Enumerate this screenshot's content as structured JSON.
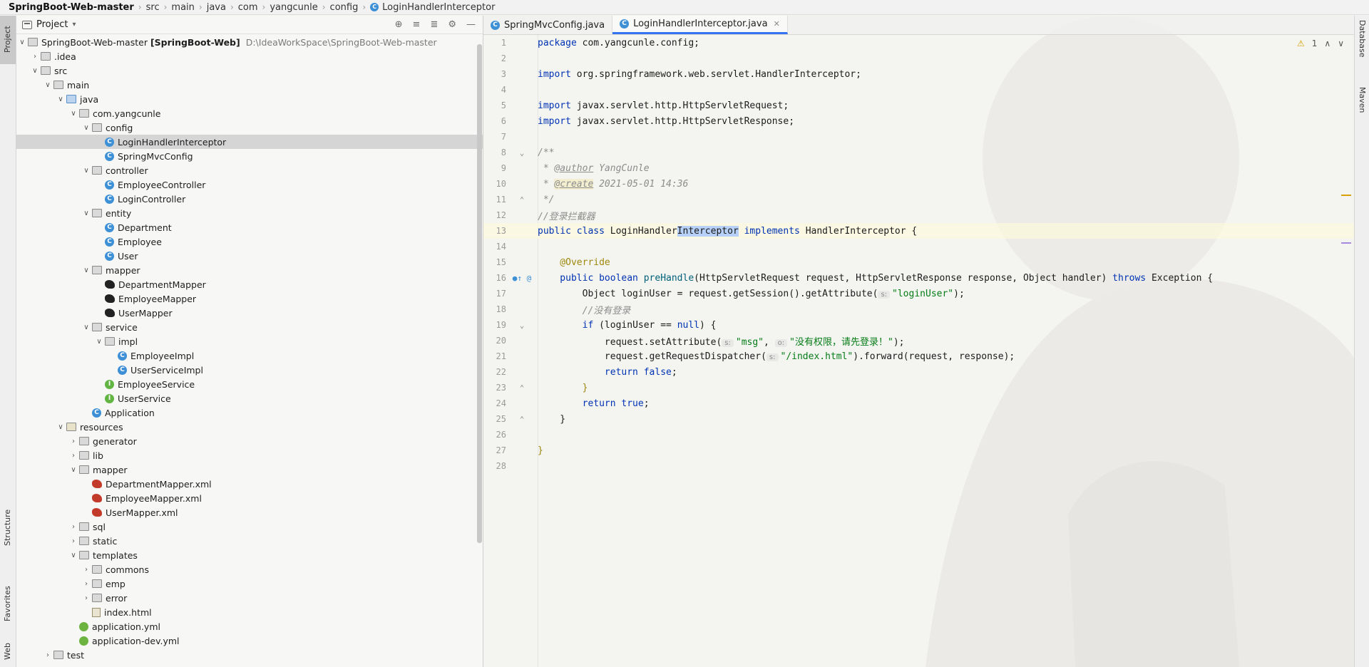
{
  "breadcrumb": {
    "items": [
      "SpringBoot-Web-master",
      "src",
      "main",
      "java",
      "com",
      "yangcunle",
      "config",
      "LoginHandlerInterceptor"
    ]
  },
  "left_strip": {
    "project": "Project",
    "structure": "Structure",
    "favorites": "Favorites",
    "web": "Web"
  },
  "right_strip": {
    "database": "Database",
    "maven": "Maven"
  },
  "project_panel": {
    "title": "Project",
    "root_name": "SpringBoot-Web-master",
    "root_module": "[SpringBoot-Web]",
    "root_path": "D:\\IdeaWorkSpace\\SpringBoot-Web-master",
    "items": [
      {
        "label": ".idea"
      },
      {
        "label": "src"
      },
      {
        "label": "main"
      },
      {
        "label": "java"
      },
      {
        "label": "com.yangcunle"
      },
      {
        "label": "config"
      },
      {
        "label": "LoginHandlerInterceptor"
      },
      {
        "label": "SpringMvcConfig"
      },
      {
        "label": "controller"
      },
      {
        "label": "EmployeeController"
      },
      {
        "label": "LoginController"
      },
      {
        "label": "entity"
      },
      {
        "label": "Department"
      },
      {
        "label": "Employee"
      },
      {
        "label": "User"
      },
      {
        "label": "mapper"
      },
      {
        "label": "DepartmentMapper"
      },
      {
        "label": "EmployeeMapper"
      },
      {
        "label": "UserMapper"
      },
      {
        "label": "service"
      },
      {
        "label": "impl"
      },
      {
        "label": "EmployeeImpl"
      },
      {
        "label": "UserServiceImpl"
      },
      {
        "label": "EmployeeService"
      },
      {
        "label": "UserService"
      },
      {
        "label": "Application"
      },
      {
        "label": "resources"
      },
      {
        "label": "generator"
      },
      {
        "label": "lib"
      },
      {
        "label": "mapper"
      },
      {
        "label": "DepartmentMapper.xml"
      },
      {
        "label": "EmployeeMapper.xml"
      },
      {
        "label": "UserMapper.xml"
      },
      {
        "label": "sql"
      },
      {
        "label": "static"
      },
      {
        "label": "templates"
      },
      {
        "label": "commons"
      },
      {
        "label": "emp"
      },
      {
        "label": "error"
      },
      {
        "label": "index.html"
      },
      {
        "label": "application.yml"
      },
      {
        "label": "application-dev.yml"
      },
      {
        "label": "test"
      }
    ]
  },
  "tabs": [
    {
      "label": "SpringMvcConfig.java",
      "active": false
    },
    {
      "label": "LoginHandlerInterceptor.java",
      "active": true
    }
  ],
  "editor": {
    "warning_count": "1",
    "line_numbers": [
      "1",
      "2",
      "3",
      "4",
      "5",
      "6",
      "7",
      "8",
      "9",
      "10",
      "11",
      "12",
      "13",
      "14",
      "15",
      "16",
      "17",
      "18",
      "19",
      "20",
      "21",
      "22",
      "23",
      "24",
      "25",
      "26",
      "27",
      "28"
    ],
    "code": {
      "l1_kw": "package",
      "l1_rest": " com.yangcunle.config;",
      "l3_kw": "import",
      "l3_rest": " org.springframework.web.servlet.HandlerInterceptor;",
      "l5_kw": "import",
      "l5_rest": " javax.servlet.http.HttpServletRequest;",
      "l6_kw": "import",
      "l6_rest": " javax.servlet.http.HttpServletResponse;",
      "l8": "/**",
      "l9_pre": " * ",
      "l9_tag": "@author",
      "l9_rest": " YangCunle",
      "l10_pre": " * ",
      "l10_tag": "@create",
      "l10_rest": " 2021-05-01 14:36",
      "l11": " */",
      "l12": "//登录拦截器",
      "l13_kw": "public class ",
      "l13_name": "LoginHandler",
      "l13_hl": "Interceptor",
      "l13_kw2": " implements ",
      "l13_rest": "HandlerInterceptor {",
      "l15": "    @Override",
      "l16_kw": "    public boolean ",
      "l16_m": "preHandle",
      "l16_rest": "(HttpServletRequest request, HttpServletResponse response, Object handler) ",
      "l16_kw2": "throws",
      "l16_end": " Exception {",
      "l17_pre": "        Object loginUser = request.getSession().getAttribute(",
      "l17_hint": "s:",
      "l17_str": "\"loginUser\"",
      "l17_end": ");",
      "l18": "        //没有登录",
      "l19_kw": "        if",
      "l19_mid": " (loginUser == ",
      "l19_kw2": "null",
      "l19_end": ") {",
      "l20_pre": "            request.setAttribute(",
      "l20_hint1": "s:",
      "l20_str1": "\"msg\"",
      "l20_mid": ", ",
      "l20_hint2": "o:",
      "l20_str2": "\"没有权限，请先登录！\"",
      "l20_end": ");",
      "l21_pre": "            request.getRequestDispatcher(",
      "l21_hint": "s:",
      "l21_str": "\"/index.html\"",
      "l21_end": ").forward(request, response);",
      "l22_kw": "            return ",
      "l22_kw2": "false",
      "l22_end": ";",
      "l23": "        }",
      "l24_kw": "        return ",
      "l24_kw2": "true",
      "l24_end": ";",
      "l25": "    }",
      "l27": "}"
    }
  }
}
